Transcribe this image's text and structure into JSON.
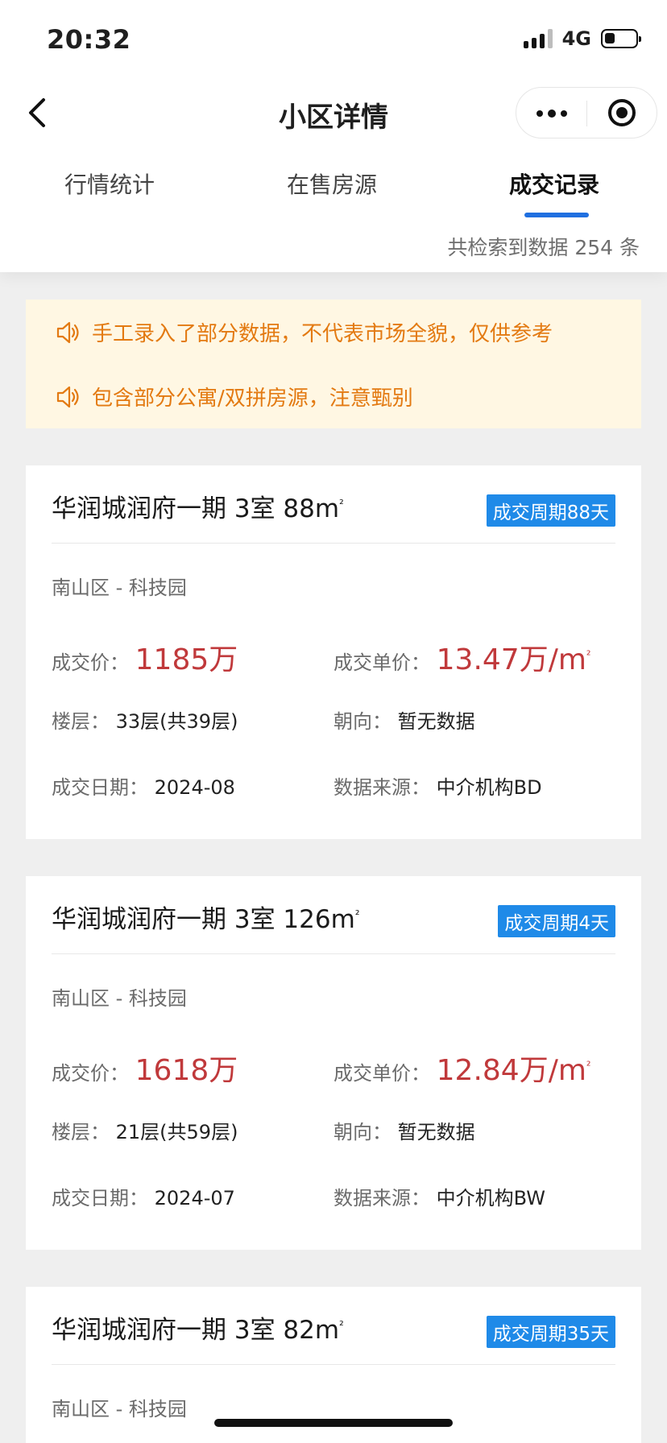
{
  "status": {
    "time": "20:32",
    "network": "4G"
  },
  "nav": {
    "title": "小区详情"
  },
  "tabs": [
    {
      "label": "行情统计"
    },
    {
      "label": "在售房源"
    },
    {
      "label": "成交记录"
    }
  ],
  "active_tab": "成交记录",
  "result_count": "共检索到数据 254 条",
  "notices": [
    "手工录入了部分数据，不代表市场全貌，仅供参考",
    "包含部分公寓/双拼房源，注意甄别"
  ],
  "labels": {
    "price": "成交价：",
    "unit_price": "成交单价：",
    "floor": "楼层：",
    "orientation": "朝向：",
    "date": "成交日期：",
    "source": "数据来源："
  },
  "listings": [
    {
      "title": "华润城润府一期 3室 88m",
      "sup": "²",
      "badge": "成交周期88天",
      "district": "南山区 - 科技园",
      "price": "1185万",
      "unit_price": "13.47万/m",
      "unit_sup": "²",
      "floor": "33层(共39层)",
      "orientation": "暂无数据",
      "date": "2024-08",
      "source": "中介机构BD"
    },
    {
      "title": "华润城润府一期 3室 126m",
      "sup": "²",
      "badge": "成交周期4天",
      "district": "南山区 - 科技园",
      "price": "1618万",
      "unit_price": "12.84万/m",
      "unit_sup": "²",
      "floor": "21层(共59层)",
      "orientation": "暂无数据",
      "date": "2024-07",
      "source": "中介机构BW"
    },
    {
      "title": "华润城润府一期 3室 82m",
      "sup": "²",
      "badge": "成交周期35天",
      "district": "南山区 - 科技园"
    }
  ],
  "colors": {
    "accent": "#1f6fe0",
    "badge": "#1f8ae8",
    "price": "#c0393b",
    "notice_text": "#e37a12",
    "notice_bg": "#fff7e3"
  },
  "icons": [
    "back-arrow-icon",
    "more-dots-icon",
    "target-close-icon",
    "speaker-icon"
  ]
}
